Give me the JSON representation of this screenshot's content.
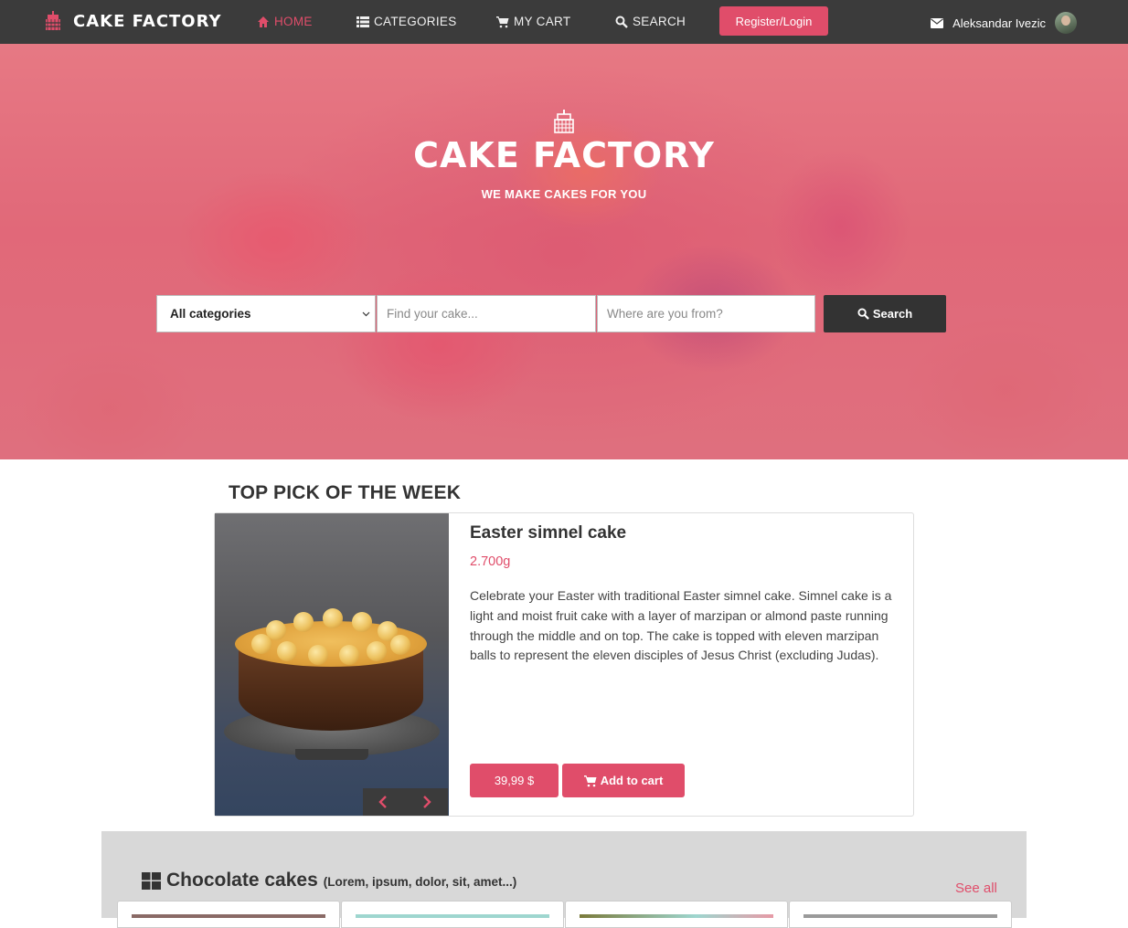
{
  "nav": {
    "brand": "CAKE FACTORY",
    "items": [
      {
        "label": "HOME",
        "icon": "home-icon",
        "active": true
      },
      {
        "label": "CATEGORIES",
        "icon": "list-icon"
      },
      {
        "label": "MY CART",
        "icon": "cart-icon"
      },
      {
        "label": "SEARCH",
        "icon": "search-icon"
      }
    ],
    "register_label": "Register/Login",
    "user_name": "Aleksandar Ivezic",
    "accent": "#e04d6a",
    "bg": "#3b3b3b"
  },
  "hero": {
    "title": "CAKE FACTORY",
    "subtitle": "WE MAKE CAKES FOR YOU",
    "category_select": "All categories",
    "search_placeholder": "Find your cake...",
    "location_placeholder": "Where are you from?",
    "search_button": "Search"
  },
  "top_pick": {
    "heading": "TOP PICK OF THE WEEK",
    "name": "Easter simnel cake",
    "weight": "2.700g",
    "description": "Celebrate your Easter with traditional Easter simnel cake. Simnel cake is a light and moist fruit cake with a layer of marzipan or almond paste running through the middle and on top. The cake is topped with eleven marzipan balls to represent the eleven disciples of Jesus Christ (excluding Judas).",
    "price": "39,99 $",
    "add_to_cart": "Add to cart"
  },
  "category_section": {
    "name": "Chocolate cakes",
    "subtitle": "(Lorem, ipsum, dolor, sit, amet...)",
    "see_all": "See all"
  }
}
